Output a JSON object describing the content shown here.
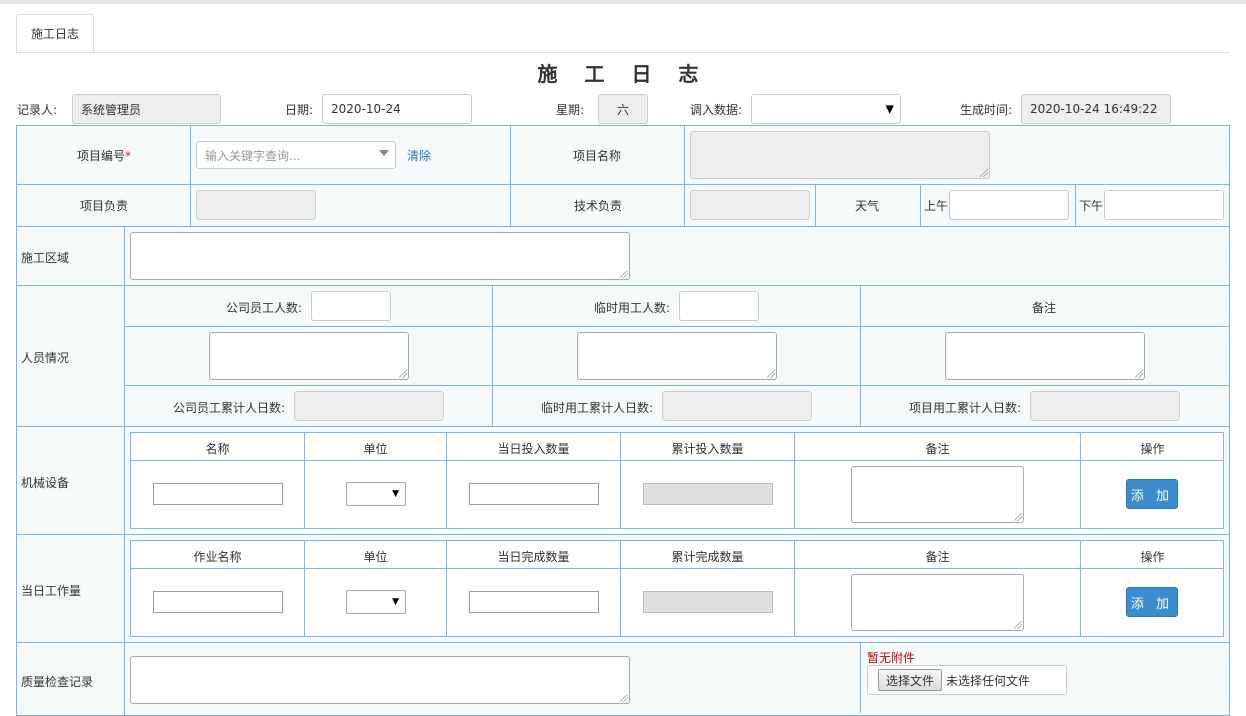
{
  "tab": {
    "label": "施工日志"
  },
  "page": {
    "title": "施 工 日 志"
  },
  "header": {
    "recorder_label": "记录人:",
    "recorder_value": "系统管理员",
    "date_label": "日期:",
    "date_value": "2020-10-24",
    "weekday_label": "星期:",
    "weekday_value": "六",
    "import_label": "调入数据:",
    "import_value": "",
    "generated_label": "生成时间:",
    "generated_value": "2020-10-24 16:49:22"
  },
  "project": {
    "code_label": "项目编号",
    "required_mark": "*",
    "code_placeholder": "输入关键字查询...",
    "clear_label": "清除",
    "name_label": "项目名称",
    "manager_label": "项目负责",
    "tech_label": "技术负责",
    "weather_label": "天气",
    "am_label": "上午",
    "pm_label": "下午"
  },
  "area": {
    "label": "施工区域"
  },
  "personnel": {
    "label": "人员情况",
    "company_workers_label": "公司员工人数:",
    "temp_workers_label": "临时用工人数:",
    "remarks_label": "备注",
    "company_cumulative_label": "公司员工累计人日数:",
    "temp_cumulative_label": "临时用工累计人日数:",
    "project_cumulative_label": "项目用工累计人日数:"
  },
  "machinery": {
    "label": "机械设备",
    "columns": [
      "名称",
      "单位",
      "当日投入数量",
      "累计投入数量",
      "备注",
      "操作"
    ],
    "add_label": "添 加"
  },
  "workload": {
    "label": "当日工作量",
    "columns": [
      "作业名称",
      "单位",
      "当日完成数量",
      "累计完成数量",
      "备注",
      "操作"
    ],
    "add_label": "添 加"
  },
  "quality": {
    "label": "质量检查记录",
    "no_attachment": "暂无附件",
    "choose_file_label": "选择文件",
    "no_file_selected": "未选择任何文件"
  },
  "colors": {
    "border": "#7fb7d8",
    "cell_bg": "#f5fbfb",
    "button": "#3c8dcd",
    "required": "#e02020",
    "warning": "#cc0000",
    "link": "#2a7bbd"
  }
}
